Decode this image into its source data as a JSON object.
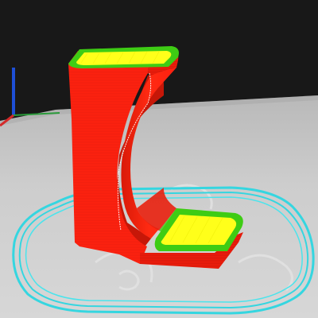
{
  "viewport": {
    "view_mode": "preview",
    "background_color": "#181818",
    "bed_color": "#cfcfcf",
    "bed_grid_color": "#d9d9d9",
    "axes": {
      "z_color": "#1e4fd6",
      "x_color": "#d42a2a",
      "y_color": "#2a9a3a"
    }
  },
  "toolpath_colors": {
    "perimeter": "#ff2010",
    "external_perimeter": "#ff1400",
    "solid_infill": "#ffff1a",
    "top_solid_infill_edge": "#3ecc14",
    "skirt": "#35d6e0",
    "seam": "#ffffff"
  },
  "model": {
    "shape": "c-bracket"
  }
}
